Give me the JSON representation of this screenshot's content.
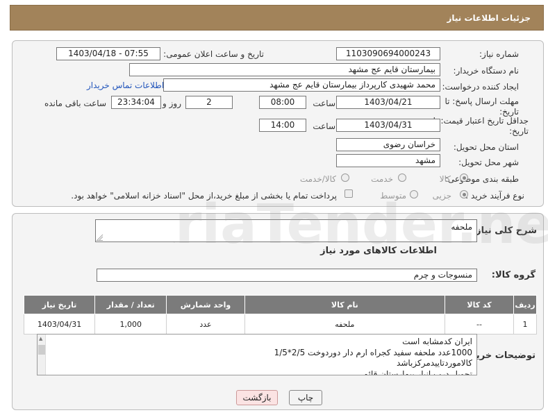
{
  "header": {
    "title": "جزئیات اطلاعات نیاز"
  },
  "form": {
    "need_number": {
      "label": "شماره نیاز:",
      "value": "1103090694000243"
    },
    "announce_datetime": {
      "label": "تاریخ و ساعت اعلان عمومی:",
      "value": "1403/04/18 - 07:55"
    },
    "buyer_org": {
      "label": "نام دستگاه خریدار:",
      "value": "بیمارستان قایم  عج  مشهد"
    },
    "requester": {
      "label": "ایجاد کننده درخواست:",
      "value": "محمد شهیدی کارپرداز بیمارستان قایم  عج  مشهد",
      "contact_link": "اطلاعات تماس خریدار"
    },
    "reply_deadline": {
      "label_line1": "مهلت ارسال پاسخ: تا",
      "label_line2": "تاریخ:",
      "date": "1403/04/21",
      "time_label": "ساعت",
      "time": "08:00",
      "days": "2",
      "days_label": "روز و",
      "remaining": "23:34:04",
      "remaining_label": "ساعت باقی مانده"
    },
    "price_validity": {
      "label_line1": "جداقل تاریخ اعتبار قیمت: تا",
      "label_line2": "تاریخ:",
      "date": "1403/04/31",
      "time_label": "ساعت",
      "time": "14:00"
    },
    "province": {
      "label": "استان محل تحویل:",
      "value": "خراسان رضوی"
    },
    "city": {
      "label": "شهر محل تحویل:",
      "value": "مشهد"
    },
    "category": {
      "label": "طبقه بندی موضوعی:",
      "options": [
        "کالا",
        "خدمت",
        "کالا/خدمت"
      ]
    },
    "purchase_type": {
      "label": "نوع فرآیند خرید :",
      "options": [
        "جزیی",
        "متوسط"
      ],
      "note": "پرداخت تمام یا بخشی از مبلغ خرید،از محل \"اسناد خزانه اسلامی\" خواهد بود."
    }
  },
  "description": {
    "label": "شرح کلی نیاز:",
    "value": "ملحفه"
  },
  "goods_info": {
    "title": "اطلاعات کالاهای مورد نیاز"
  },
  "goods_group": {
    "label": "گروه کالا:",
    "value": "منسوجات و چرم"
  },
  "table": {
    "headers": [
      "ردیف",
      "کد کالا",
      "نام کالا",
      "واحد شمارش",
      "تعداد / مقدار",
      "تاریخ نیاز"
    ],
    "rows": [
      [
        "1",
        "--",
        "ملحفه",
        "عدد",
        "1,000",
        "1403/04/31"
      ]
    ]
  },
  "buyer_notes": {
    "label": "توضیحات خریدار:",
    "lines": [
      "ایران کدمشابه است",
      "1000عدد ملحفه  سفید کجراه ارم دار دوردوخت 2/5*1/5",
      "کالاموردتاییدمرکزباشد",
      "تحویل درب انبار بیمارستان قائم"
    ]
  },
  "buttons": {
    "print": "چاپ",
    "back": "بازگشت"
  },
  "watermark": {
    "text": "AriaTender.neT"
  }
}
